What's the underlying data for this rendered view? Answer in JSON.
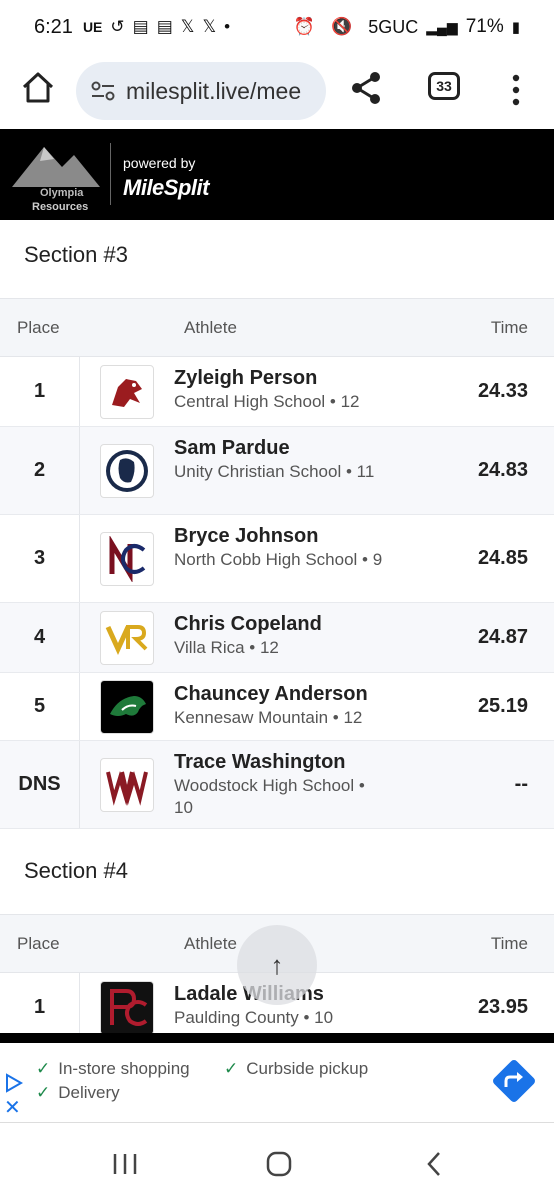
{
  "status_bar": {
    "time": "6:21",
    "left_icons": [
      "UE",
      "sync-icon",
      "news-icon",
      "news-icon",
      "x-icon",
      "x-icon",
      "dot"
    ],
    "network": "5GUC",
    "battery": "71%"
  },
  "browser": {
    "url": "milesplit.live/mee",
    "tab_count": "33"
  },
  "banner": {
    "logo_line1": "Olympia",
    "logo_line2": "Resources",
    "powered_by": "powered by",
    "brand": "MileSplit"
  },
  "columns": {
    "place": "Place",
    "athlete": "Athlete",
    "time": "Time"
  },
  "section3": {
    "title": "Section #3",
    "rows": [
      {
        "place": "1",
        "name": "Zyleigh Person",
        "school": "Central High School • 12",
        "time": "24.33"
      },
      {
        "place": "2",
        "name": "Sam Pardue",
        "school": "Unity Christian School • 11",
        "time": "24.83"
      },
      {
        "place": "3",
        "name": "Bryce Johnson",
        "school": "North Cobb High School • 9",
        "time": "24.85"
      },
      {
        "place": "4",
        "name": "Chris Copeland",
        "school": "Villa Rica • 12",
        "time": "24.87"
      },
      {
        "place": "5",
        "name": "Chauncey Anderson",
        "school": "Kennesaw Mountain • 12",
        "time": "25.19"
      },
      {
        "place": "DNS",
        "name": "Trace Washington",
        "school": "Woodstock High School • 10",
        "time": "--"
      }
    ]
  },
  "section4": {
    "title": "Section #4",
    "rows": [
      {
        "place": "1",
        "name": "Ladale Williams",
        "school": "Paulding County • 10",
        "time": "23.95"
      }
    ]
  },
  "ad": {
    "item1": "In-store shopping",
    "item2": "Curbside pickup",
    "item3": "Delivery"
  },
  "colors": {
    "brand_black": "#000000",
    "check_green": "#1f8a4c",
    "ad_blue": "#1a73e8"
  }
}
